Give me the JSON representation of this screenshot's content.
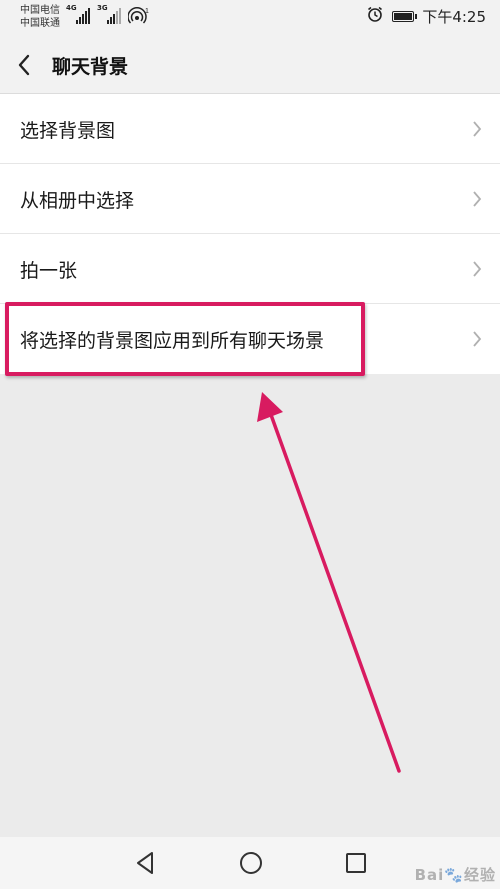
{
  "status_bar": {
    "carrier_1": "中国电信",
    "carrier_2": "中国联通",
    "network_1": "4G",
    "network_2": "3G",
    "hotspot_count": "1",
    "time": "下午4:25"
  },
  "header": {
    "title": "聊天背景"
  },
  "menu": {
    "items": [
      {
        "label": "选择背景图"
      },
      {
        "label": "从相册中选择"
      },
      {
        "label": "拍一张"
      },
      {
        "label": "将选择的背景图应用到所有聊天场景"
      }
    ]
  },
  "annotation": {
    "color": "#d81b60"
  },
  "watermark": {
    "text": "Bai🐾经验"
  }
}
